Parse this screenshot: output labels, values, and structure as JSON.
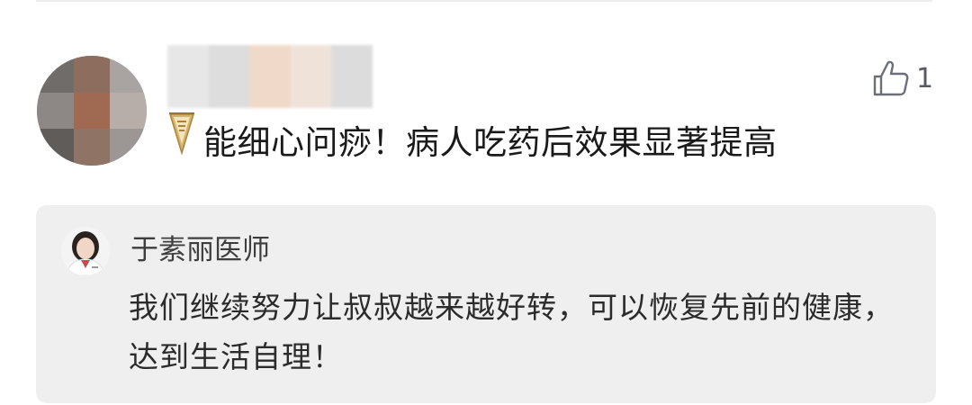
{
  "comment": {
    "text": "能细心问痧！病人吃药后效果显著提高",
    "likes": "1",
    "avatar_icon": "avatar-pixelated",
    "like_icon": "thumbs-up-icon",
    "badge_icon": "pennant-badge-icon"
  },
  "reply": {
    "author": "于素丽医师",
    "text": "我们继续努力让叔叔越来越好转，可以恢复先前的健康，达到生活自理！",
    "avatar_icon": "doctor-avatar"
  },
  "colors": {
    "text_primary": "#1a1a1a",
    "reply_bg": "#efefef",
    "like_color": "#555a66",
    "badge_gold": "#c9a24c"
  }
}
